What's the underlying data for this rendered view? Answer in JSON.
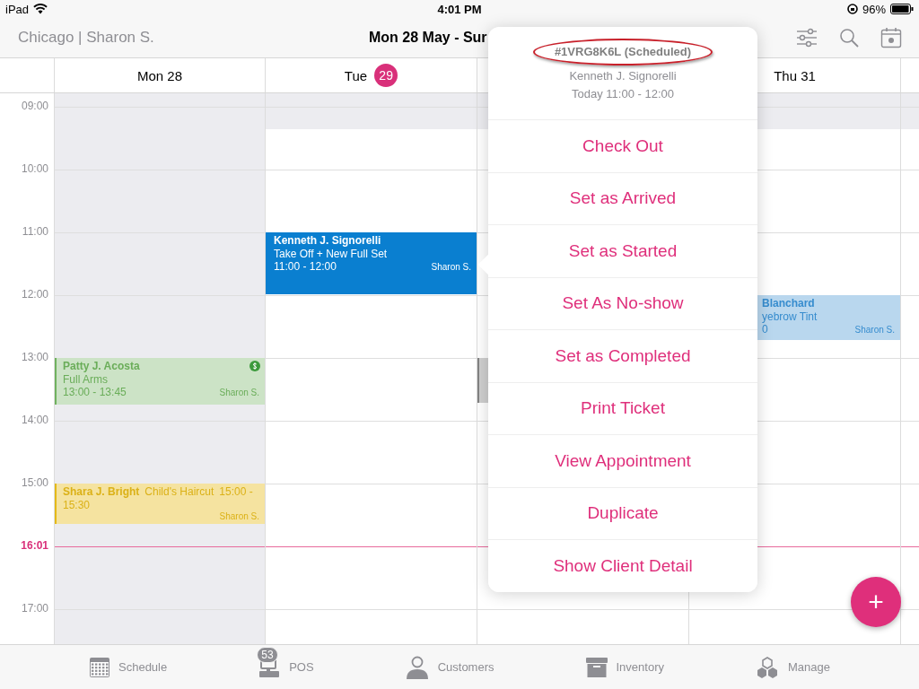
{
  "status_bar": {
    "device": "iPad",
    "time": "4:01 PM",
    "battery": "96%"
  },
  "header": {
    "location": "Chicago | Sharon S.",
    "date_range": "Mon 28 May - Sur"
  },
  "days": [
    {
      "label": "Mon 28",
      "off": true
    },
    {
      "label": "Tue",
      "badge": "29",
      "off": false
    },
    {
      "off": false
    },
    {
      "label": "Thu 31",
      "off": false
    },
    {
      "off": false
    }
  ],
  "hours": [
    {
      "kind": "hour",
      "label": "09:00"
    },
    {
      "kind": "hour",
      "label": "10:00"
    },
    {
      "kind": "hour",
      "label": "11:00",
      "cells": [
        null,
        {
          "name": "Kenneth J. Signorelli",
          "service": "Take Off + New Full Set",
          "time": "11:00 - 12:00",
          "staff": "Sharon S.",
          "color": "#0a7fd0",
          "selected": true,
          "paid": false,
          "kind": "full"
        },
        null,
        null,
        null
      ]
    },
    {
      "kind": "hour",
      "label": "12:00",
      "cells": [
        null,
        null,
        null,
        {
          "name": "Blanchard",
          "service": "yebrow Tint",
          "time": "0",
          "staff": "Sharon S.",
          "color": "#b9d7ee",
          "selected": false,
          "paid": false,
          "kind": "full"
        },
        null
      ]
    },
    {
      "kind": "hour",
      "label": "13:00",
      "cells": [
        {
          "name": "Patty J. Acosta",
          "service": "Full Arms",
          "time": "13:00 - 13:45",
          "staff": "Sharon S.",
          "color": "#cce3c6",
          "selected": false,
          "paid": true,
          "kind": "full"
        },
        null,
        {
          "color": "#cfcfcf",
          "selected": false,
          "kind": "full"
        },
        null,
        null
      ]
    },
    {
      "kind": "hour",
      "label": "14:00"
    },
    {
      "kind": "hour",
      "label": "15:00",
      "cells": [
        {
          "name": "Shara J. Bright",
          "service": "Child's Haircut",
          "time": "15:00 - 15:30",
          "staff": "Sharon S.",
          "color": "#f5e3a0",
          "selected": false,
          "paid": false,
          "kind": "compact"
        },
        null,
        null,
        null,
        null
      ]
    },
    {
      "kind": "now",
      "label": "16:01"
    },
    {
      "kind": "hour",
      "label": "17:00"
    }
  ],
  "popover": {
    "code": "#1VRG8K6L (Scheduled)",
    "highlighted": true,
    "client": "Kenneth J. Signorelli",
    "when": "Today 11:00 - 12:00",
    "actions": [
      "Check Out",
      "Set as Arrived",
      "Set as Started",
      "Set As No-show",
      "Set as Completed",
      "Print Ticket",
      "View Appointment",
      "Duplicate",
      "Show Client Detail"
    ]
  },
  "fab": {
    "label": "+"
  },
  "tabs": [
    {
      "label": "Schedule"
    },
    {
      "label": "POS",
      "badge": "53"
    },
    {
      "label": "Customers"
    },
    {
      "label": "Inventory"
    },
    {
      "label": "Manage"
    }
  ]
}
